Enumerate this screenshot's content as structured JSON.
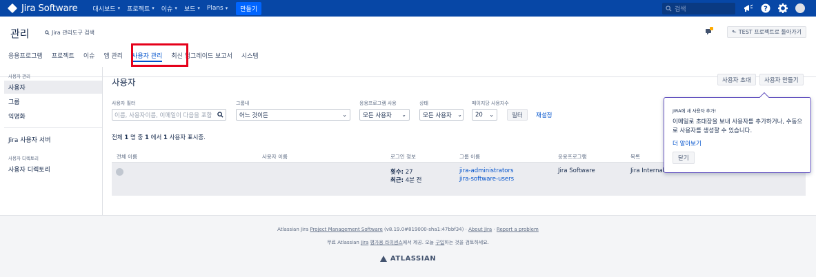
{
  "topnav": {
    "logo_text": "Jira Software",
    "items": [
      {
        "label": "대시보드"
      },
      {
        "label": "프로젝트"
      },
      {
        "label": "이슈"
      },
      {
        "label": "보드"
      },
      {
        "label": "Plans"
      }
    ],
    "create_label": "만들기",
    "search_placeholder": "검색",
    "bg_color": "#0747a6",
    "create_color": "#0065ff"
  },
  "admin": {
    "title": "관리",
    "search_label": "Jira 관리도구 검색",
    "back_button": "TEST 프로젝트로 돌아가기",
    "tabs": [
      {
        "label": "응용프로그램"
      },
      {
        "label": "프로젝트"
      },
      {
        "label": "이슈"
      },
      {
        "label": "앱 관리"
      },
      {
        "label": "사용자 관리"
      },
      {
        "label": "최신 업그레이드 보고서"
      },
      {
        "label": "시스템"
      }
    ],
    "highlight_color": "#e5001a"
  },
  "sidebar": {
    "group1": "사용자 관리",
    "items1": [
      {
        "label": "사용자"
      },
      {
        "label": "그룹"
      },
      {
        "label": "익명화"
      }
    ],
    "server_link": "Jira 사용자 서버",
    "group2": "사용자 디렉토리",
    "dir_link": "사용자 디렉토리"
  },
  "main": {
    "heading": "사용자",
    "invite_button": "사용자 초대",
    "create_user_button": "사용자 만들기",
    "filters": {
      "user_filter_label": "사용자 필터",
      "user_filter_placeholder": "이름, 사용자이름, 이메일이 다음을 포함",
      "group_label": "그룹내",
      "group_value": "어느 것이든",
      "app_label": "응용프로그램 사용",
      "app_value": "모든 사용자",
      "status_label": "상태",
      "status_value": "모든 사용자",
      "per_page_label": "페이지당 사용자수",
      "per_page_value": "20",
      "filter_button": "필터",
      "reset_link": "재설정"
    },
    "summary": {
      "prefix": "전체",
      "total": "1",
      "mid1": "명 중",
      "from": "1",
      "mid2": "에서",
      "to": "1",
      "suffix": "사용자 표시중."
    },
    "table": {
      "headers": [
        "전체 이름",
        "사용자 이름",
        "로그인 정보",
        "그룹 이름",
        "응용프로그램",
        "목록"
      ],
      "row": {
        "login_count_label": "횟수:",
        "login_count": "27",
        "last_label": "최근:",
        "last_value": "4분 전",
        "groups": [
          "jira-administrators",
          "jira-software-users"
        ],
        "application": "Jira Software",
        "directory": "Jira Internal"
      }
    }
  },
  "popup": {
    "title": "JIRA에 새 사용자 추가!",
    "body": "이메일로 초대장을 보내 사용자를 추가하거나, 수동으로 사용자를 생성할 수 있습니다.",
    "learn_more": "더 알아보기",
    "close": "닫기",
    "border_color": "#6554c0"
  },
  "footer": {
    "line1_prefix": "Atlassian Jira",
    "line1_link1": "Project Management Software",
    "line1_version": "(v8.19.0#819000-sha1:47bbf34)",
    "line1_sep1": "·",
    "line1_link2": "About Jira",
    "line1_sep2": "·",
    "line1_link3": "Report a problem",
    "line2_prefix": "무료 Atlassian",
    "line2_link1": "Jira",
    "line2_link2": "평가용 라이센스",
    "line2_mid": "에서 제공. 오늘",
    "line2_link3": "구입",
    "line2_suffix": "하는 것을 검토하세요.",
    "brand": "ATLASSIAN"
  }
}
